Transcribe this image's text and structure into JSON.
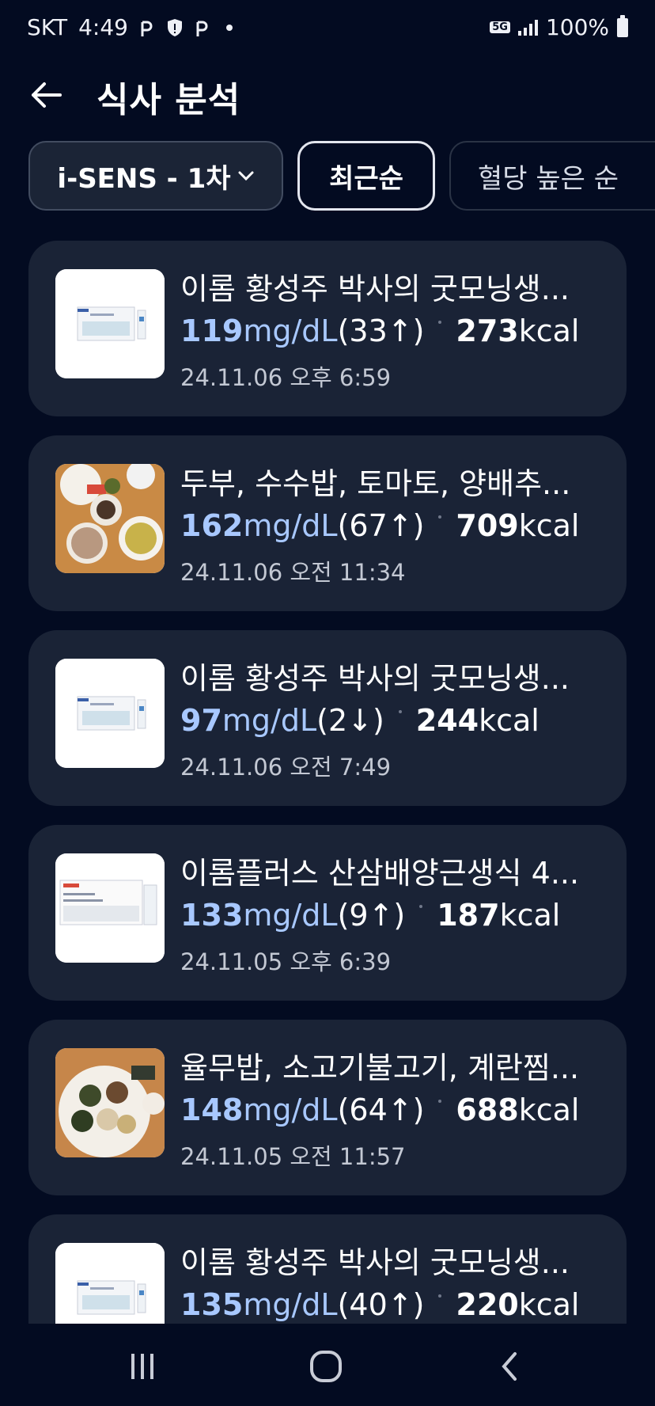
{
  "status_bar": {
    "carrier": "SKT",
    "time": "4:49",
    "network": "5G",
    "battery": "100%",
    "icons": [
      "p-icon",
      "shield-icon",
      "p-icon",
      "dot-icon",
      "network-5g-icon",
      "signal-icon",
      "battery-icon"
    ]
  },
  "header": {
    "title": "식사 분석",
    "back_icon": "arrow-left-icon"
  },
  "filters": {
    "device": "i-SENS - 1차",
    "device_icon": "chevron-down-icon",
    "sort_recent": "최근순",
    "sort_high_glucose": "혈당 높은 순"
  },
  "meals": [
    {
      "name": "이롬 황성주 박사의 굿모닝생...",
      "glucose": "119",
      "unit": "mg/dL",
      "delta": "(33↑)",
      "kcal": "273",
      "kcal_unit": "kcal",
      "time": "24.11.06 오후 6:59",
      "thumb": "product-box"
    },
    {
      "name": "두부, 수수밥, 토마토, 양배추...",
      "glucose": "162",
      "unit": "mg/dL",
      "delta": "(67↑)",
      "kcal": "709",
      "kcal_unit": "kcal",
      "time": "24.11.06 오전 11:34",
      "thumb": "meal-photo"
    },
    {
      "name": "이롬 황성주 박사의 굿모닝생...",
      "glucose": "97",
      "unit": "mg/dL",
      "delta": "(2↓)",
      "kcal": "244",
      "kcal_unit": "kcal",
      "time": "24.11.06 오전 7:49",
      "thumb": "product-box"
    },
    {
      "name": "이롬플러스 산삼배양근생식 4...",
      "glucose": "133",
      "unit": "mg/dL",
      "delta": "(9↑)",
      "kcal": "187",
      "kcal_unit": "kcal",
      "time": "24.11.05 오후 6:39",
      "thumb": "product-box"
    },
    {
      "name": "율무밥, 소고기불고기, 계란찜...",
      "glucose": "148",
      "unit": "mg/dL",
      "delta": "(64↑)",
      "kcal": "688",
      "kcal_unit": "kcal",
      "time": "24.11.05 오전 11:57",
      "thumb": "meal-photo"
    },
    {
      "name": "이롬 황성주 박사의 굿모닝생...",
      "glucose": "135",
      "unit": "mg/dL",
      "delta": "(40↑)",
      "kcal": "220",
      "kcal_unit": "kcal",
      "time": "",
      "thumb": "product-box"
    }
  ],
  "nav": {
    "icons": [
      "recent-apps-icon",
      "home-icon",
      "back-icon"
    ]
  },
  "colors": {
    "background": "#030b21",
    "card": "#1a2336",
    "glucose_accent": "#a8c8ff"
  }
}
